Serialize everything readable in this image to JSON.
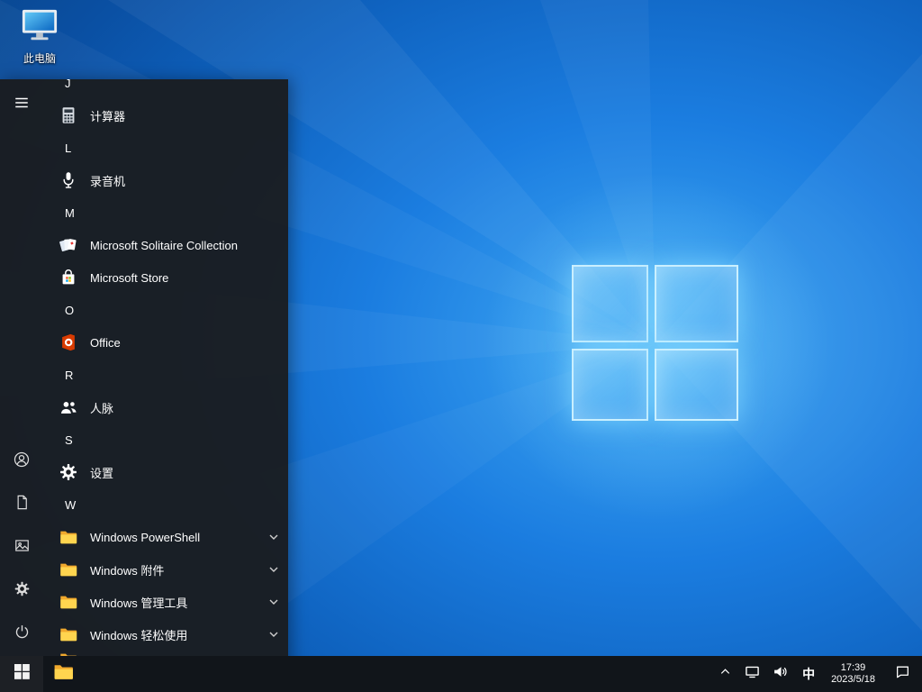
{
  "colors": {
    "desktop_blue": "#1b7de0",
    "menu_bg": "#1a1d21",
    "taskbar_bg": "#11151a",
    "folder_yellow": "#ffd54f",
    "office_orange": "#d83b01",
    "accent": "#0078d7"
  },
  "desktop": {
    "this_pc": {
      "label": "此电脑",
      "icon": "computer-icon"
    }
  },
  "start_menu": {
    "app_list": [
      {
        "type": "letter",
        "label": "J"
      },
      {
        "type": "app",
        "label": "计算器",
        "icon": "calculator-icon"
      },
      {
        "type": "letter",
        "label": "L"
      },
      {
        "type": "app",
        "label": "录音机",
        "icon": "microphone-icon"
      },
      {
        "type": "letter",
        "label": "M"
      },
      {
        "type": "app",
        "label": "Microsoft Solitaire Collection",
        "icon": "solitaire-cards-icon"
      },
      {
        "type": "app",
        "label": "Microsoft Store",
        "icon": "store-bag-icon"
      },
      {
        "type": "letter",
        "label": "O"
      },
      {
        "type": "app",
        "label": "Office",
        "icon": "office-icon"
      },
      {
        "type": "letter",
        "label": "R"
      },
      {
        "type": "app",
        "label": "人脉",
        "icon": "people-icon"
      },
      {
        "type": "letter",
        "label": "S"
      },
      {
        "type": "app",
        "label": "设置",
        "icon": "gear-icon"
      },
      {
        "type": "letter",
        "label": "W"
      },
      {
        "type": "folder",
        "label": "Windows PowerShell",
        "icon": "folder-icon",
        "expander": "chevron-down-icon"
      },
      {
        "type": "folder",
        "label": "Windows 附件",
        "icon": "folder-icon",
        "expander": "chevron-down-icon"
      },
      {
        "type": "folder",
        "label": "Windows 管理工具",
        "icon": "folder-icon",
        "expander": "chevron-down-icon"
      },
      {
        "type": "folder",
        "label": "Windows 轻松使用",
        "icon": "folder-icon",
        "expander": "chevron-down-icon"
      },
      {
        "type": "folder",
        "label": "",
        "icon": "folder-icon"
      }
    ],
    "rail": [
      {
        "name": "menu",
        "icon": "hamburger-icon"
      },
      {
        "name": "account",
        "icon": "user-icon"
      },
      {
        "name": "documents",
        "icon": "document-icon"
      },
      {
        "name": "pictures",
        "icon": "pictures-icon"
      },
      {
        "name": "settings",
        "icon": "gear-icon"
      },
      {
        "name": "power",
        "icon": "power-icon"
      }
    ]
  },
  "taskbar": {
    "start": {
      "icon": "windows-logo-icon"
    },
    "file_explorer": {
      "icon": "folder-icon"
    },
    "tray": {
      "hidden_icons": {
        "icon": "chevron-up-icon"
      },
      "network": {
        "icon": "ethernet-icon"
      },
      "volume": {
        "icon": "speaker-icon"
      },
      "ime": "中",
      "clock": {
        "time": "17:39",
        "date": "2023/5/18"
      },
      "action_center": {
        "icon": "action-center-icon"
      }
    }
  }
}
